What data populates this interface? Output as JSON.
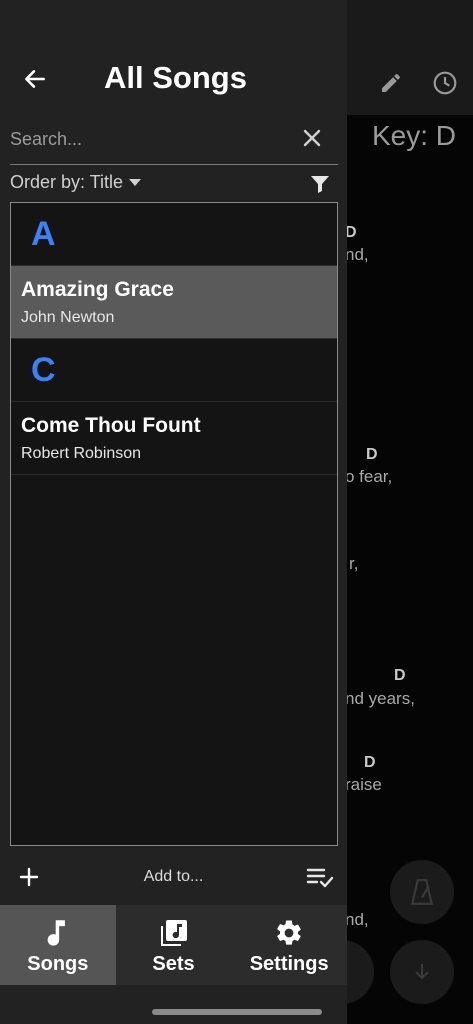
{
  "background": {
    "key_label": "Key: D",
    "chords": [
      "D",
      "D",
      "D",
      "D"
    ],
    "lyric_fragments": [
      "nd,",
      "o fear,",
      "r,",
      "nd years,",
      "raise",
      "nd,"
    ]
  },
  "drawer": {
    "title": "All Songs",
    "search": {
      "placeholder": "Search...",
      "value": ""
    },
    "order_by": "Order by: Title",
    "sections": [
      {
        "letter": "A",
        "songs": [
          {
            "title": "Amazing Grace",
            "author": "John Newton",
            "selected": true
          }
        ]
      },
      {
        "letter": "C",
        "songs": [
          {
            "title": "Come Thou Fount",
            "author": "Robert Robinson",
            "selected": false
          }
        ]
      }
    ],
    "add_to_label": "Add to...",
    "tabs": [
      {
        "label": "Songs",
        "icon": "music-note-icon",
        "active": true
      },
      {
        "label": "Sets",
        "icon": "library-music-icon",
        "active": false
      },
      {
        "label": "Settings",
        "icon": "gear-icon",
        "active": false
      }
    ]
  },
  "colors": {
    "accent": "#3b82f6",
    "drawer_bg": "#222222",
    "selected_row": "#5a5a5a"
  }
}
